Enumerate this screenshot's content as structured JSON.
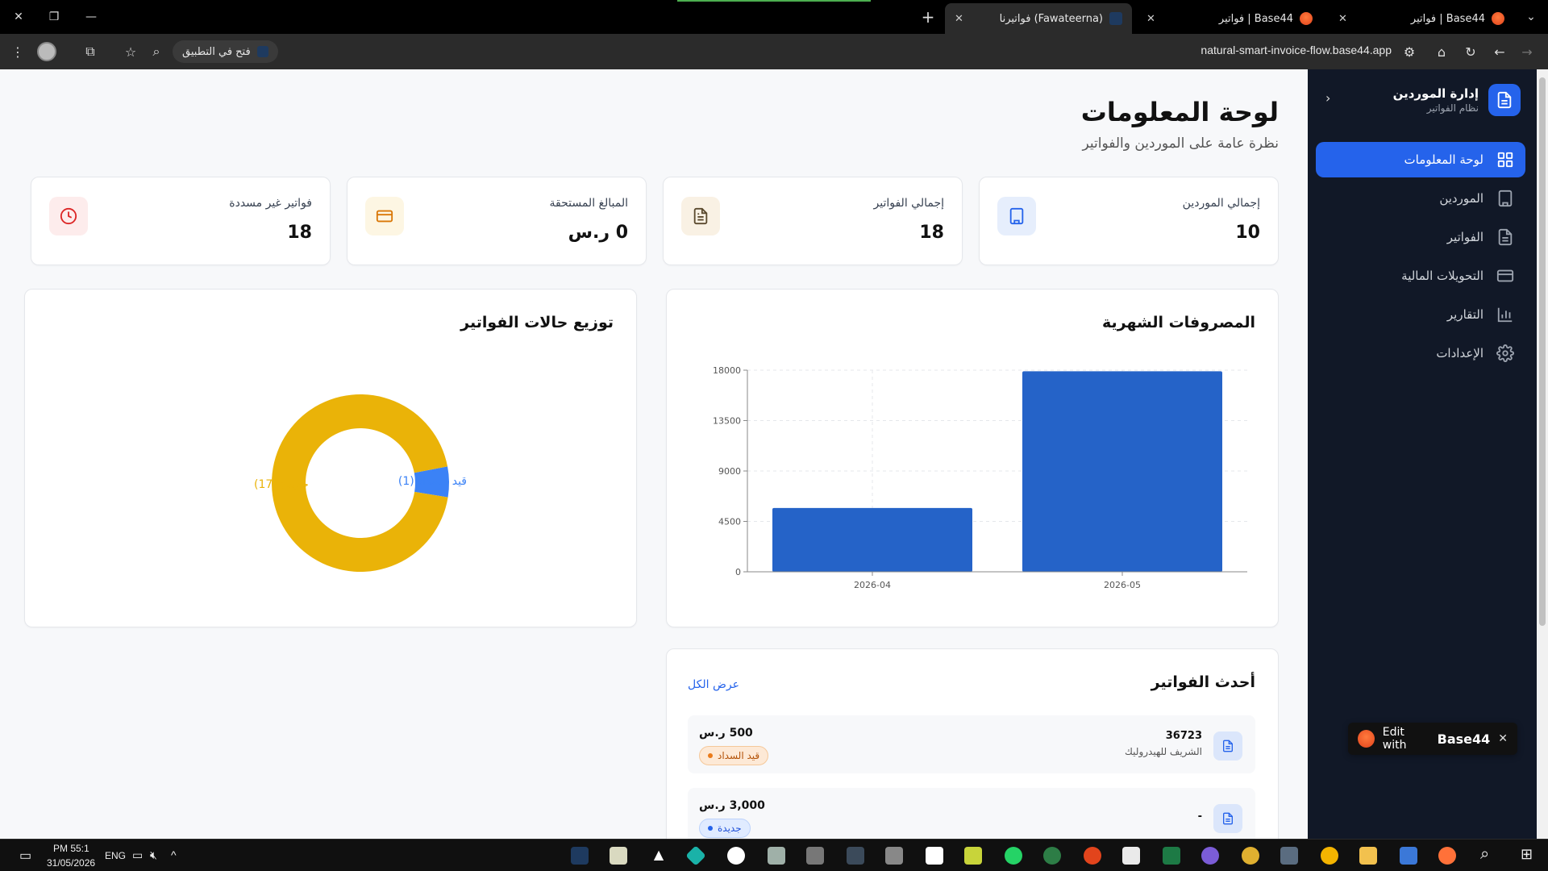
{
  "browser": {
    "tabs": [
      {
        "title": "فواتير | Base44",
        "active": false
      },
      {
        "title": "فواتير | Base44",
        "active": false
      },
      {
        "title": "فواتيرنا (Fawateerna)",
        "active": true
      }
    ],
    "url": "natural-smart-invoice-flow.base44.app",
    "open_in_app": "فتح في التطبيق"
  },
  "sidebar": {
    "brand_title": "إدارة الموردين",
    "brand_subtitle": "نظام الفواتير",
    "items": [
      {
        "label": "لوحة المعلومات",
        "icon": "dashboard-icon",
        "active": true
      },
      {
        "label": "الموردين",
        "icon": "building-icon",
        "active": false
      },
      {
        "label": "الفواتير",
        "icon": "file-icon",
        "active": false
      },
      {
        "label": "التحويلات المالية",
        "icon": "credit-card-icon",
        "active": false
      },
      {
        "label": "التقارير",
        "icon": "bar-chart-icon",
        "active": false
      },
      {
        "label": "الإعدادات",
        "icon": "settings-icon",
        "active": false
      }
    ]
  },
  "header": {
    "title": "لوحة المعلومات",
    "subtitle": "نظرة عامة على الموردين والفواتير"
  },
  "stats": [
    {
      "label": "إجمالي الموردين",
      "value": "10",
      "icon": "building-icon",
      "color": "#2563eb",
      "bg": "#e6eefc"
    },
    {
      "label": "إجمالي الفواتير",
      "value": "18",
      "icon": "file-text-icon",
      "color": "#a16207",
      "bg": "#f9f1e4"
    },
    {
      "label": "المبالغ المستحقة",
      "value": "0 ر.س",
      "icon": "credit-card-icon",
      "color": "#d97706",
      "bg": "#fdf6e3"
    },
    {
      "label": "فواتير غير مسددة",
      "value": "18",
      "icon": "clock-icon",
      "color": "#dc2626",
      "bg": "#fdecec"
    }
  ],
  "monthly_chart": {
    "title": "المصروفات الشهرية",
    "chart_data": {
      "type": "bar",
      "categories": [
        "2026-04",
        "2026-05"
      ],
      "values": [
        5700,
        17900
      ],
      "yticks": [
        0,
        4500,
        9000,
        13500,
        18000
      ],
      "ylim": [
        0,
        18000
      ],
      "color": "#2563c8",
      "grid": true
    }
  },
  "status_chart": {
    "title": "توزيع حالات الفواتير",
    "chart_data": {
      "type": "pie",
      "donut": true,
      "series": [
        {
          "name": "قيد السداد",
          "value": 1,
          "color": "#3b82f6",
          "label": "قيد السداد (1)"
        },
        {
          "name": "جديدة",
          "value": 17,
          "color": "#eab308",
          "label": "جديدة (17)"
        }
      ]
    }
  },
  "latest_invoices": {
    "title": "أحدث الفواتير",
    "view_all": "عرض الكل",
    "rows": [
      {
        "number": "36723",
        "supplier": "الشريف للهيدروليك",
        "amount": "500 ر.س",
        "status": "قيد السداد",
        "status_type": "pending"
      },
      {
        "number": "-",
        "supplier": "",
        "amount": "3,000 ر.س",
        "status": "جديدة",
        "status_type": "new"
      }
    ]
  },
  "toast": {
    "text": "Edit with",
    "brand": "Base44"
  },
  "taskbar": {
    "time": "PM 55:1",
    "date": "31/05/2026",
    "lang": "ENG"
  }
}
